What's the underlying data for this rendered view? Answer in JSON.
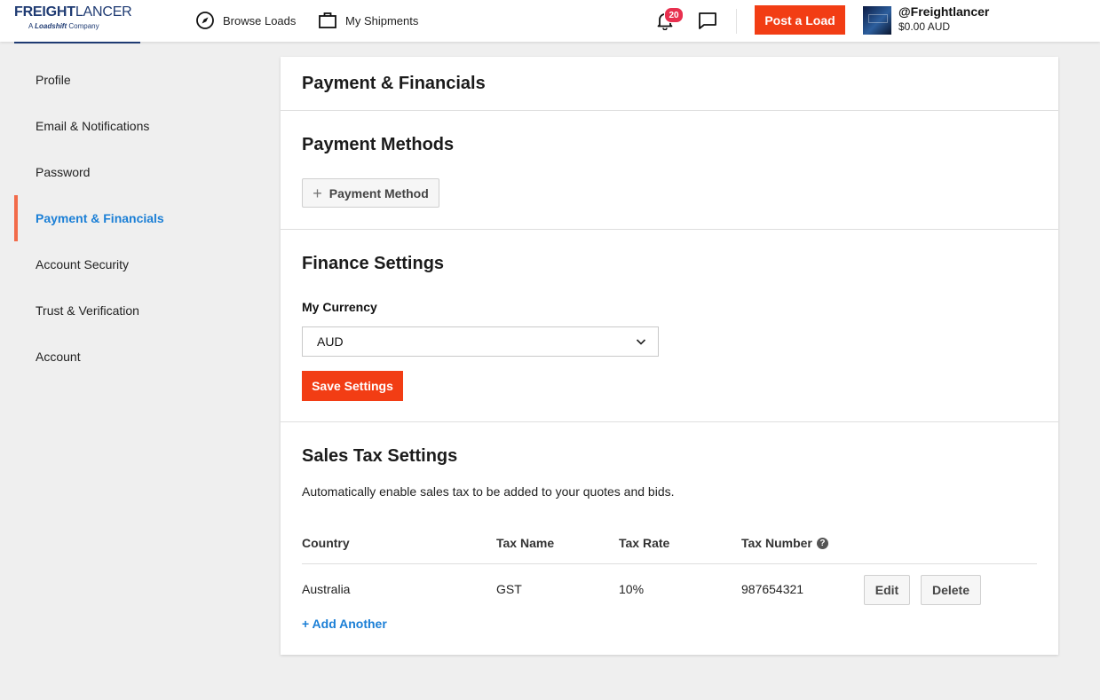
{
  "header": {
    "logo_freight": "FREIGHT",
    "logo_lancer": "LANCER",
    "logo_sub_a": "A",
    "logo_sub_brand": "Loadshift",
    "logo_sub_company": "Company",
    "browse_loads": "Browse Loads",
    "my_shipments": "My Shipments",
    "notification_count": "20",
    "post_load": "Post a Load",
    "username": "@Freightlancer",
    "balance": "$0.00 AUD"
  },
  "sidebar": {
    "items": [
      {
        "label": "Profile",
        "active": false
      },
      {
        "label": "Email & Notifications",
        "active": false
      },
      {
        "label": "Password",
        "active": false
      },
      {
        "label": "Payment & Financials",
        "active": true
      },
      {
        "label": "Account Security",
        "active": false
      },
      {
        "label": "Trust & Verification",
        "active": false
      },
      {
        "label": "Account",
        "active": false
      }
    ]
  },
  "main": {
    "page_title": "Payment & Financials",
    "payment_methods": {
      "title": "Payment Methods",
      "add_label": "Payment Method"
    },
    "finance_settings": {
      "title": "Finance Settings",
      "currency_label": "My Currency",
      "currency_value": "AUD",
      "save_label": "Save Settings"
    },
    "sales_tax": {
      "title": "Sales Tax Settings",
      "description": "Automatically enable sales tax to be added to your quotes and bids.",
      "columns": [
        "Country",
        "Tax Name",
        "Tax Rate",
        "Tax Number"
      ],
      "rows": [
        {
          "country": "Australia",
          "tax_name": "GST",
          "tax_rate": "10%",
          "tax_number": "987654321"
        }
      ],
      "edit_label": "Edit",
      "delete_label": "Delete",
      "add_another": "+ Add Another"
    }
  },
  "colors": {
    "accent_orange": "#f23d14",
    "link_blue": "#1b7fd6",
    "active_marker": "#f26b4a",
    "badge": "#e8304f",
    "brand_navy": "#1f3b73"
  }
}
